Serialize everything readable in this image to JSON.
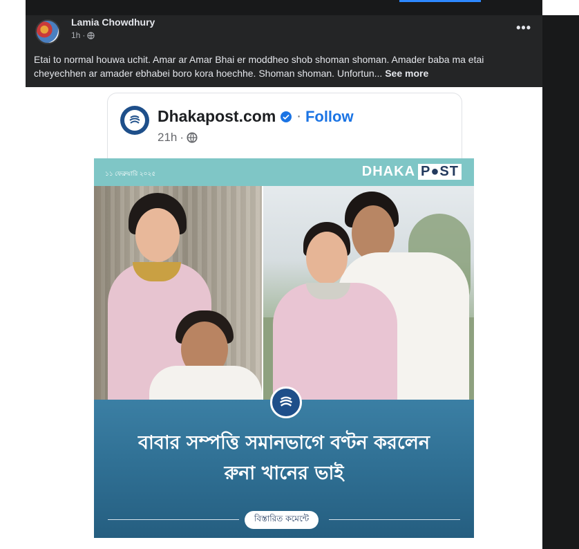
{
  "post": {
    "author": "Lamia Chowdhury",
    "time": "1h",
    "text": "Etai to normal houwa uchit. Amar ar Amar Bhai er moddheo shob shoman shoman. Amader baba ma etai cheyechhen ar amader ebhabei boro kora hoechhe. Shoman shoman. Unfortun...",
    "see_more": "See more",
    "more_icon": "•••"
  },
  "shared": {
    "page_name": "Dhakapost.com",
    "follow_label": "Follow",
    "time": "21h",
    "separator": "·"
  },
  "banner": {
    "date": "১১ ফেব্রুয়ারি ২০২৫",
    "brand_left": "DHAKA",
    "brand_right": "P●ST",
    "headline_line1": "বাবার সম্পত্তি সমানভাগে বণ্টন করলেন",
    "headline_line2": "রুনা খানের ভাই",
    "details": "বিস্তারিত কমেন্টে"
  },
  "colors": {
    "fb_dark": "#242526",
    "fb_blue": "#1b74e4",
    "banner_teal": "#7fc6c6",
    "banner_blue": "#2f6f93"
  },
  "icons": [
    "globe-icon",
    "verified-badge-icon",
    "more-options-icon",
    "dhakapost-logo-icon"
  ]
}
